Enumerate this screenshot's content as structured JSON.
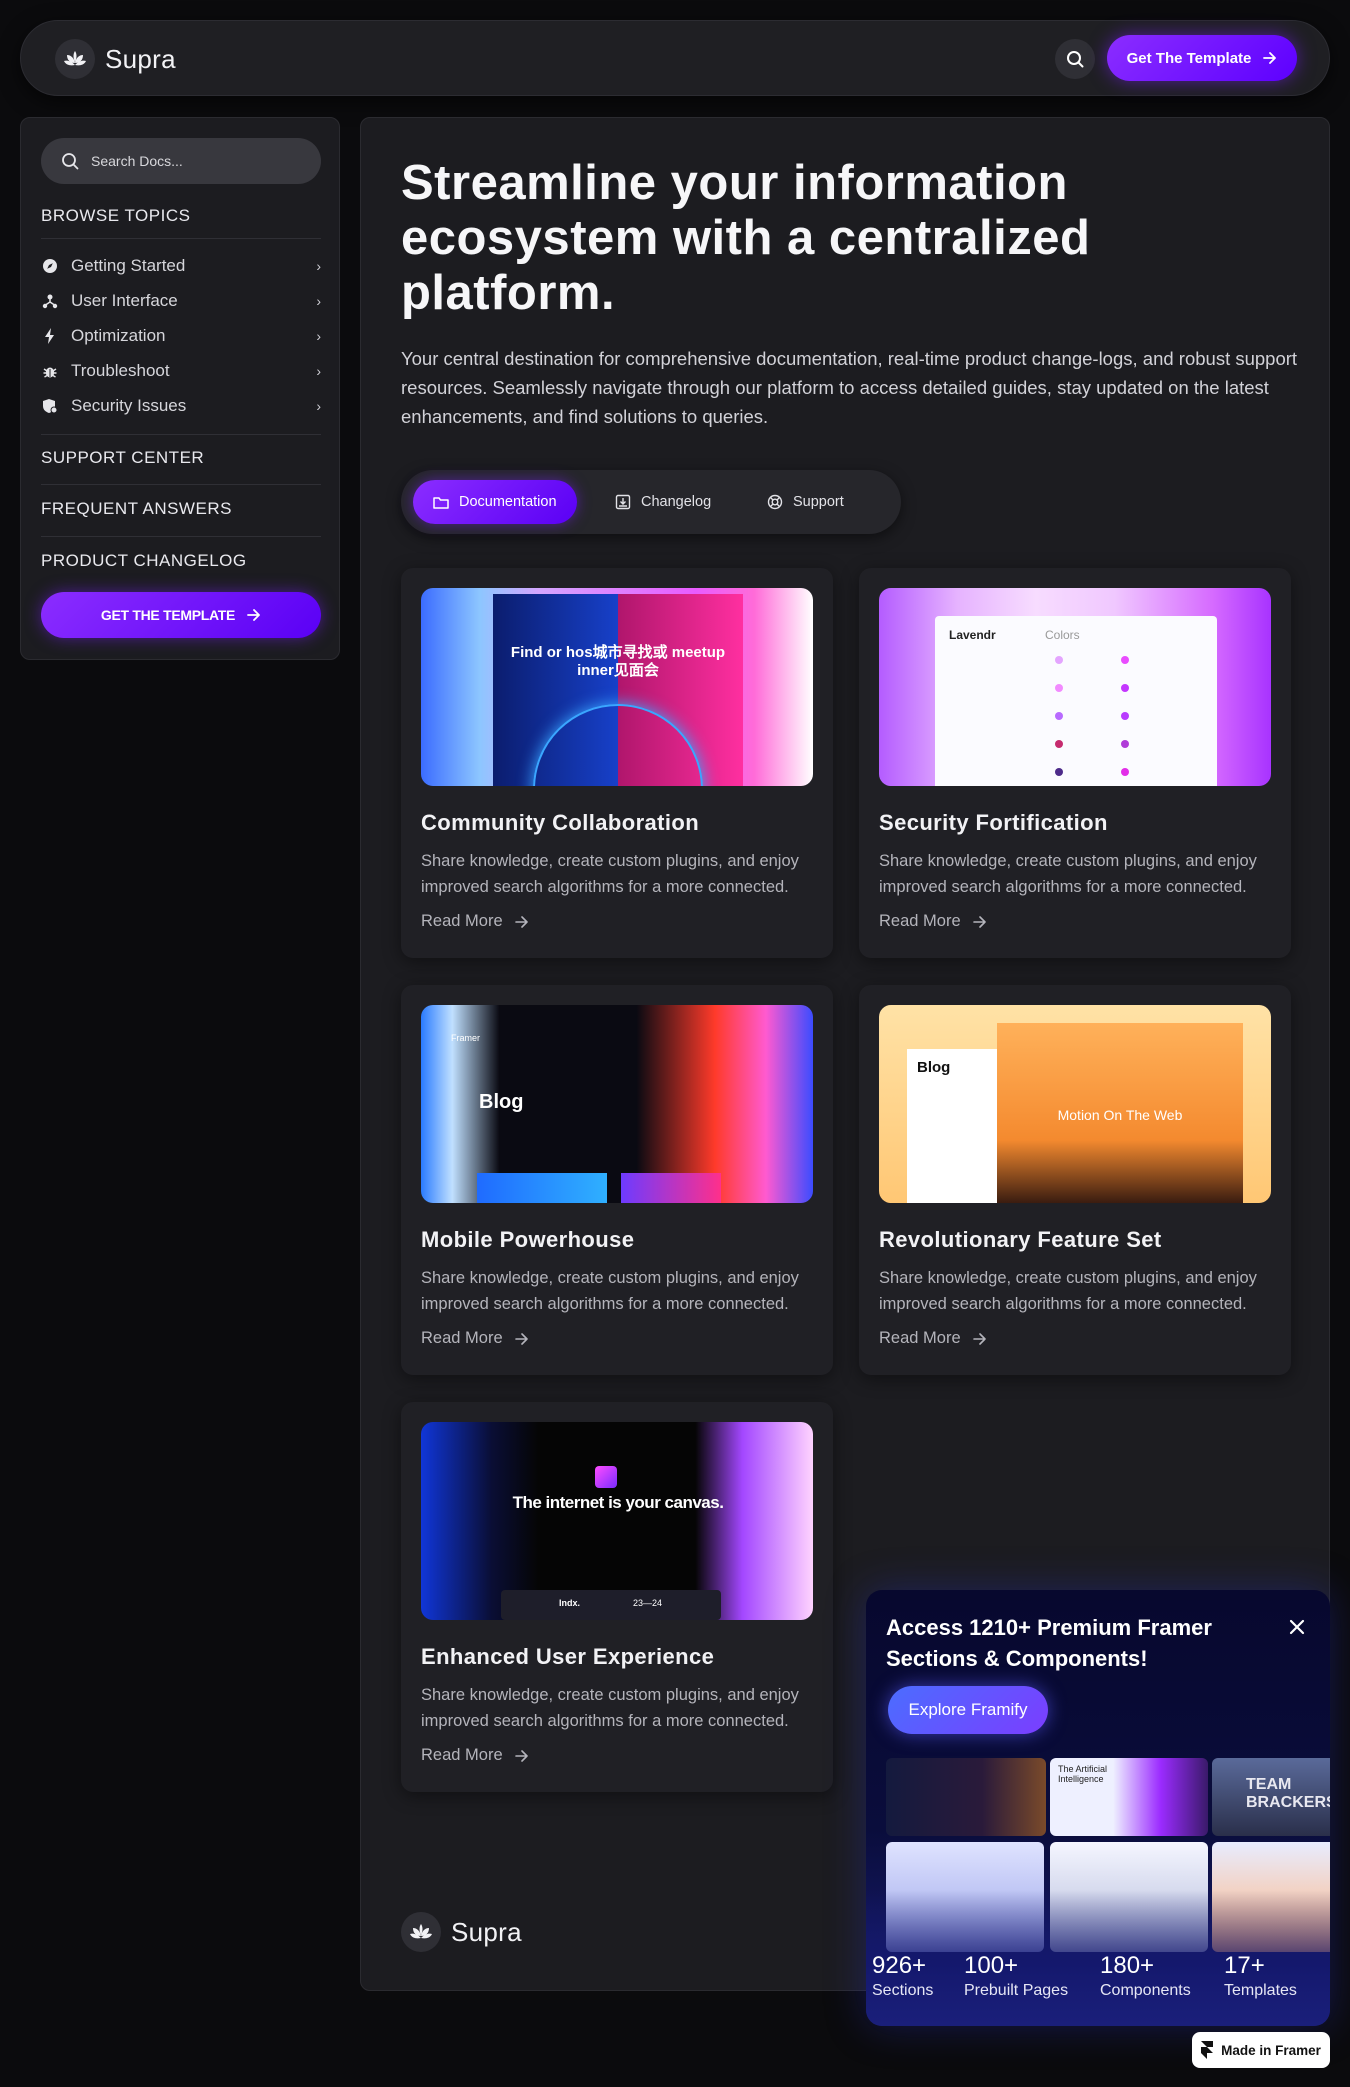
{
  "colors": {
    "accent": "#7a1dff",
    "background": "#0b0b0d",
    "panel": "#1c1c20"
  },
  "brand": {
    "name": "Supra",
    "icon": "lotus-icon"
  },
  "header": {
    "cta_label": "Get The Template",
    "search_icon": "search-icon"
  },
  "sidebar": {
    "search_placeholder": "Search Docs...",
    "browse_heading": "BROWSE TOPICS",
    "items": [
      {
        "label": "Getting Started",
        "icon": "compass-icon"
      },
      {
        "label": "User Interface",
        "icon": "network-icon"
      },
      {
        "label": "Optimization",
        "icon": "bolt-icon"
      },
      {
        "label": "Troubleshoot",
        "icon": "bug-icon"
      },
      {
        "label": "Security Issues",
        "icon": "shield-icon"
      }
    ],
    "support_center": "SUPPORT CENTER",
    "frequent_answers": "FREQUENT ANSWERS",
    "product_changelog": "PRODUCT CHANGELOG",
    "cta_label": "GET THE TEMPLATE"
  },
  "hero": {
    "title": "Streamline your information ecosystem with a centralized platform.",
    "subtitle": "Your central destination for comprehensive documentation, real-time product change-logs, and robust support resources. Seamlessly navigate through our platform to access detailed guides, stay updated on the latest enhancements, and find solutions to queries."
  },
  "tabs": [
    {
      "label": "Documentation",
      "icon": "folder-icon",
      "active": true
    },
    {
      "label": "Changelog",
      "icon": "download-box-icon",
      "active": false
    },
    {
      "label": "Support",
      "icon": "lifebuoy-icon",
      "active": false
    }
  ],
  "cards": [
    {
      "title": "Community Collaboration",
      "desc": "Share knowledge, create custom plugins, and enjoy improved search algorithms for a more connected.",
      "link": "Read More",
      "img_text": "Find or hos城市寻找或 meetup inner见面会"
    },
    {
      "title": "Security Fortification",
      "desc": "Share knowledge, create custom plugins, and enjoy improved search algorithms for a more connected.",
      "link": "Read More",
      "img_text": "Lavendr",
      "img_sub": "Colors"
    },
    {
      "title": "Mobile Powerhouse",
      "desc": "Share knowledge, create custom plugins, and enjoy improved search algorithms for a more connected.",
      "link": "Read More",
      "img_text": "Blog",
      "img_sub": "Framer"
    },
    {
      "title": "Revolutionary Feature Set",
      "desc": "Share knowledge, create custom plugins, and enjoy improved search algorithms for a more connected.",
      "link": "Read More",
      "img_text": "Blog",
      "img_sub": "Motion On The Web"
    },
    {
      "title": "Enhanced User Experience",
      "desc": "Share knowledge, create custom plugins, and enjoy improved search algorithms for a more connected.",
      "link": "Read More",
      "img_text": "The internet is your canvas.",
      "img_sub": "Indx.",
      "img_sub2": "23—24"
    }
  ],
  "promo": {
    "title": "Access 1210+ Premium Framer Sections & Components!",
    "button": "Explore Framify",
    "thumb_texts": [
      "The Artificial Intelligence",
      "TEAM BRACKERS"
    ],
    "stats": [
      {
        "num": "926+",
        "label": "Sections"
      },
      {
        "num": "100+",
        "label": "Prebuilt Pages"
      },
      {
        "num": "180+",
        "label": "Components"
      },
      {
        "num": "17+",
        "label": "Templates"
      }
    ]
  },
  "badge": {
    "label": "Made in Framer"
  }
}
